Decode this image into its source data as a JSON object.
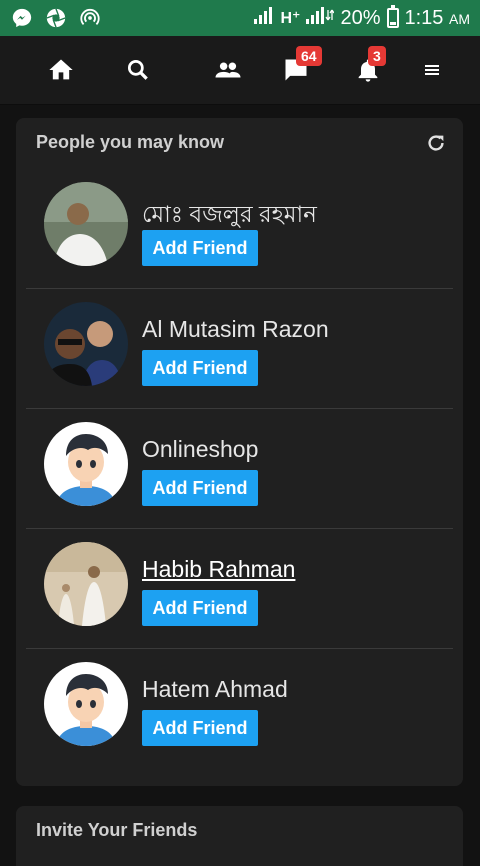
{
  "status_bar": {
    "network_label": "H⁺",
    "battery": "20%",
    "time": "1:15",
    "ampm": "AM",
    "left_icons": [
      "messenger-icon",
      "camera-aperture-icon",
      "hotspot-icon"
    ]
  },
  "nav": {
    "messages_badge": "64",
    "notifications_badge": "3"
  },
  "people_card": {
    "title": "People you may know",
    "people": [
      {
        "name": "মোঃ বজলুর রহমান",
        "button": "Add Friend"
      },
      {
        "name": "Al Mutasim Razon",
        "button": "Add Friend"
      },
      {
        "name": "Onlineshop",
        "button": "Add Friend"
      },
      {
        "name": "Habib Rahman",
        "button": "Add Friend"
      },
      {
        "name": "Hatem Ahmad",
        "button": "Add Friend"
      }
    ]
  },
  "invite_card": {
    "title": "Invite Your Friends"
  },
  "colors": {
    "status_bar": "#1f7a4c",
    "accent": "#1da1f2",
    "badge": "#e53935"
  }
}
